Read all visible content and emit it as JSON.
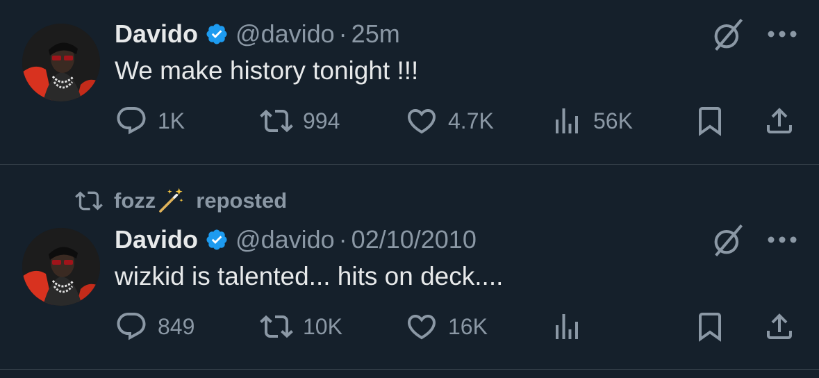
{
  "tweets": [
    {
      "author_name": "Davido",
      "handle": "@davido",
      "separator": "·",
      "time": "25m",
      "text": "We make history tonight !!!",
      "stats": {
        "replies": "1K",
        "reposts": "994",
        "likes": "4.7K",
        "views": "56K"
      }
    },
    {
      "repost_by": "fozz",
      "repost_label": "reposted",
      "author_name": "Davido",
      "handle": "@davido",
      "separator": "·",
      "time": "02/10/2010",
      "text": "wizkid is talented... hits on deck....",
      "stats": {
        "replies": "849",
        "reposts": "10K",
        "likes": "16K",
        "views": ""
      }
    }
  ],
  "icons": {
    "verified": "verified-badge-icon",
    "grok": "grok-icon",
    "more": "more-icon",
    "reply": "reply-icon",
    "repost": "repost-icon",
    "like": "like-icon",
    "views": "views-icon",
    "bookmark": "bookmark-icon",
    "share": "share-icon",
    "wand": "magic-wand-icon"
  },
  "colors": {
    "background": "#15202b",
    "text_primary": "#e7e9ea",
    "text_secondary": "#8b98a5",
    "verified_blue": "#1d9bf0",
    "divider": "#38444d"
  }
}
